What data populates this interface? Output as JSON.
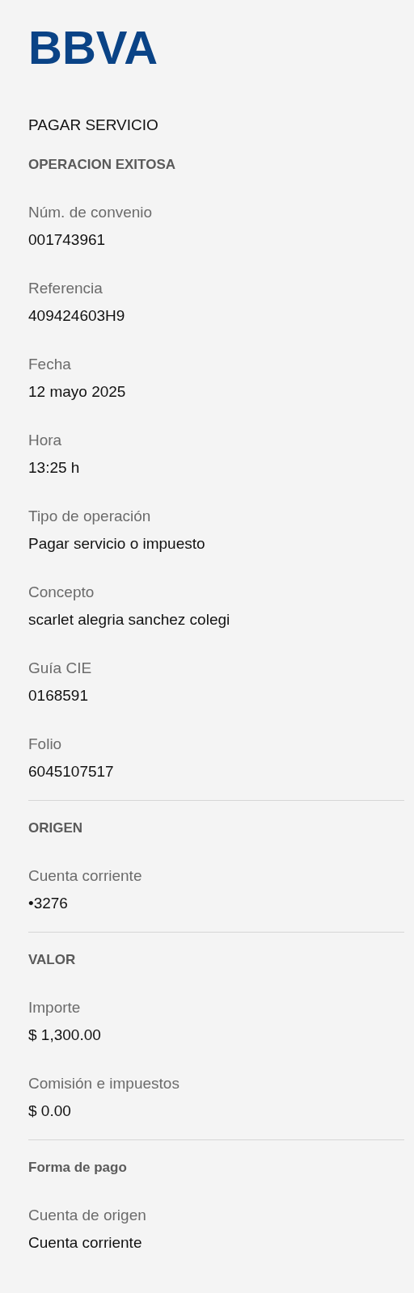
{
  "logo": "BBVA",
  "title": "PAGAR SERVICIO",
  "sections": [
    {
      "heading": "OPERACION EXITOSA",
      "divider": false,
      "fields": [
        {
          "label": "Núm. de convenio",
          "value": "001743961"
        },
        {
          "label": "Referencia",
          "value": "409424603H9"
        },
        {
          "label": "Fecha",
          "value": "12 mayo 2025"
        },
        {
          "label": "Hora",
          "value": "13:25 h"
        },
        {
          "label": "Tipo de operación",
          "value": "Pagar servicio o impuesto"
        },
        {
          "label": "Concepto",
          "value": "scarlet alegria sanchez colegi"
        },
        {
          "label": "Guía CIE",
          "value": "0168591"
        },
        {
          "label": "Folio",
          "value": "6045107517"
        }
      ]
    },
    {
      "heading": "ORIGEN",
      "divider": true,
      "fields": [
        {
          "label": "Cuenta corriente",
          "value": "•3276"
        }
      ]
    },
    {
      "heading": "VALOR",
      "divider": true,
      "fields": [
        {
          "label": "Importe",
          "value": "$ 1,300.00"
        },
        {
          "label": "Comisión e impuestos",
          "value": "$ 0.00"
        }
      ]
    },
    {
      "heading": "Forma de pago",
      "divider": true,
      "fields": [
        {
          "label": "Cuenta de origen",
          "value": "Cuenta corriente"
        }
      ]
    }
  ]
}
